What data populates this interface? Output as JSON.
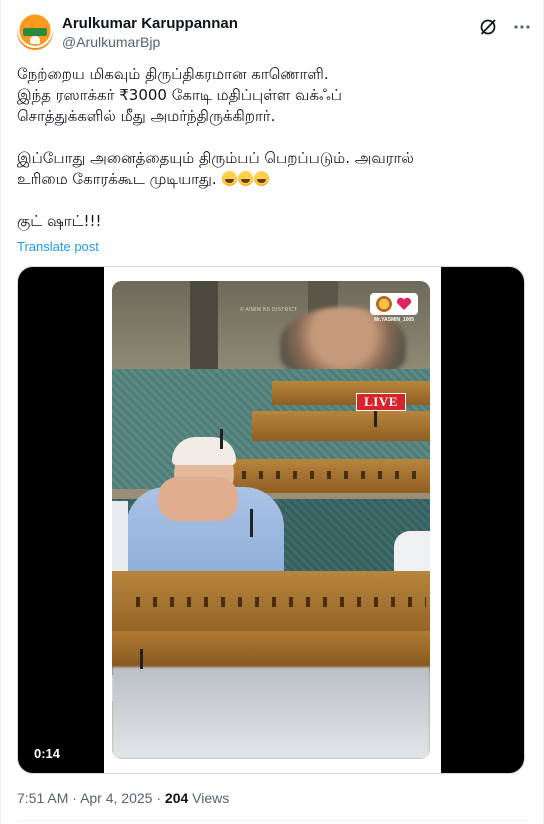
{
  "author": {
    "name": "Arulkumar Karuppannan",
    "handle": "@ArulkumarBjp",
    "avatar_icon": "bjp-lotus-avatar"
  },
  "header_icons": {
    "grok": "grok-icon",
    "more": "more-dots-icon"
  },
  "post": {
    "lines": [
      "நேற்றைய மிகவும் திருப்திகரமான காணொளி.",
      "இந்த ரஸாக்கர் ₹3000 கோடி மதிப்புள்ள வக்ஃப்",
      "சொத்துக்களில் மீது அமர்ந்திருக்கிறார்.",
      "இப்போது அனைத்தையும் திரும்பப் பெறப்படும். அவரால்",
      "உரிமை கோரக்கூட முடியாது.",
      "குட் ஷாட்!!!"
    ],
    "emoji": "rolling-on-floor-laughing-emoji",
    "emoji_count": 3,
    "translate": "Translate post"
  },
  "video": {
    "live_label": "LIVE",
    "watermark": "© AIMIM BS DISTRICT",
    "logo_caption": "Mr.YASMIN_1005",
    "duration": "0:14"
  },
  "meta": {
    "time": "7:51 AM",
    "separator": "·",
    "date": "Apr 4, 2025",
    "views_count": "204",
    "views_label": "Views"
  },
  "colors": {
    "link": "#1d9bf0",
    "secondary_text": "#536471",
    "live_red": "#d9232a"
  }
}
